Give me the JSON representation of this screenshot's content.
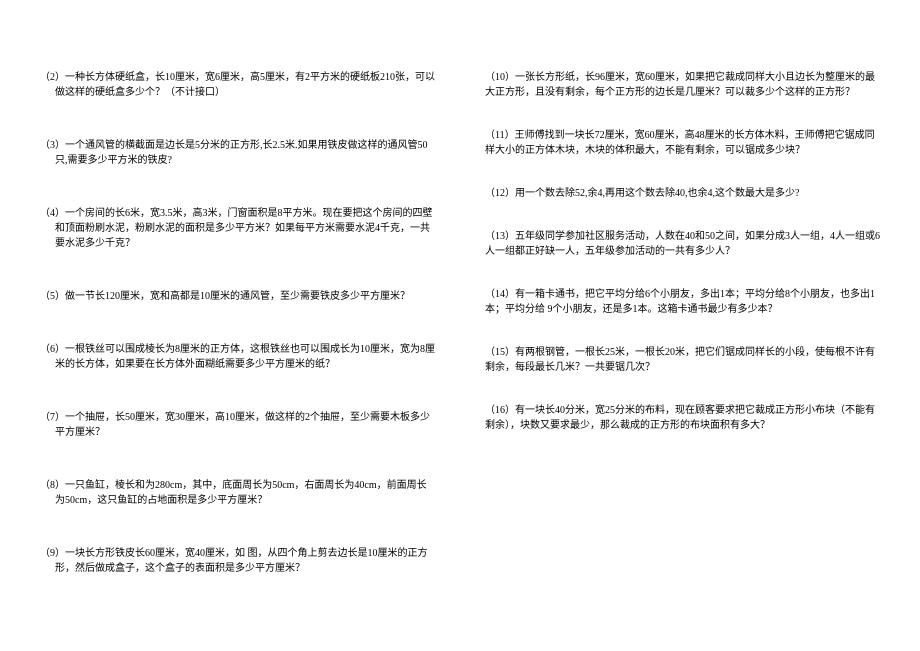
{
  "left_problems": [
    "（2）一种长方体硬纸盒，长10厘米，宽6厘米，高5厘米，有2平方米的硬纸板210张，可以做这样的硬纸盒多少个？（不计接口）",
    "（3）一个通风管的横截面是边长是5分米的正方形,长2.5米.如果用铁皮做这样的通风管50只,需要多少平方米的铁皮?",
    "（4）一个房间的长6米，宽3.5米，高3米，门窗面积是8平方米。现在要把这个房间的四壁和顶面粉刷水泥，粉刷水泥的面积是多少平方米？如果每平方米需要水泥4千克，一共要水泥多少千克？",
    "（5）做一节长120厘米，宽和高都是10厘米的通风管，至少需要铁皮多少平方厘米？",
    "（6）一根铁丝可以围成棱长为8厘米的正方体，这根铁丝也可以围成长为10厘米，宽为8厘米的长方体，如果要在长方体外面糊纸需要多少平方厘米的纸？",
    "（7）一个抽屉，长50厘米，宽30厘米，高10厘米，做这样的2个抽屉，至少需要木板多少平方厘米？",
    "（8）一只鱼缸，棱长和为280cm，其中，底面周长为50cm，右面周长为40cm，前面周长为50cm，这只鱼缸的占地面积是多少平方厘米？",
    "（9）一块长方形铁皮长60厘米，宽40厘米，如 图，从四个角上剪去边长是10厘米的正方形，然后做成盒子，这个盒子的表面积是多少平方厘米？"
  ],
  "right_problems": [
    "（10）一张长方形纸，长96厘米，宽60厘米，如果把它裁成同样大小且边长为整厘米的最大正方形，且没有剩余，每个正方形的边长是几厘米？可以裁多少个这样的正方形？",
    "（11）王师傅找到一块长72厘米，宽60厘米，高48厘米的长方体木料，王师傅把它锯成同样大小的正方体木块，木块的体积最大，不能有剩余，可以锯成多少块？",
    "（12）用一个数去除52,余4,再用这个数去除40,也余4,这个数最大是多少?",
    "（13）五年级同学参加社区服务活动，人数在40和50之间，如果分成3人一组，4人一组或6人一组都正好缺一人，五年级参加活动的一共有多少人？",
    "（14）有一箱卡通书，把它平均分给6个小朋友，多出1本；平均分给8个小朋友，也多出1本；平均分给 9个小朋友，还是多1本。这箱卡通书最少有多少本？",
    "（15）有两根钢管，一根长25米，一根长20米，把它们锯成同样长的小段，使每根不许有剩余，每段最长几米？一共要锯几次？",
    "（16）有一块长40分米，宽25分米的布料，现在顾客要求把它裁成正方形小布块（不能有剩余），块数又要求最少，那么裁成的正方形的布块面积有多大？"
  ]
}
